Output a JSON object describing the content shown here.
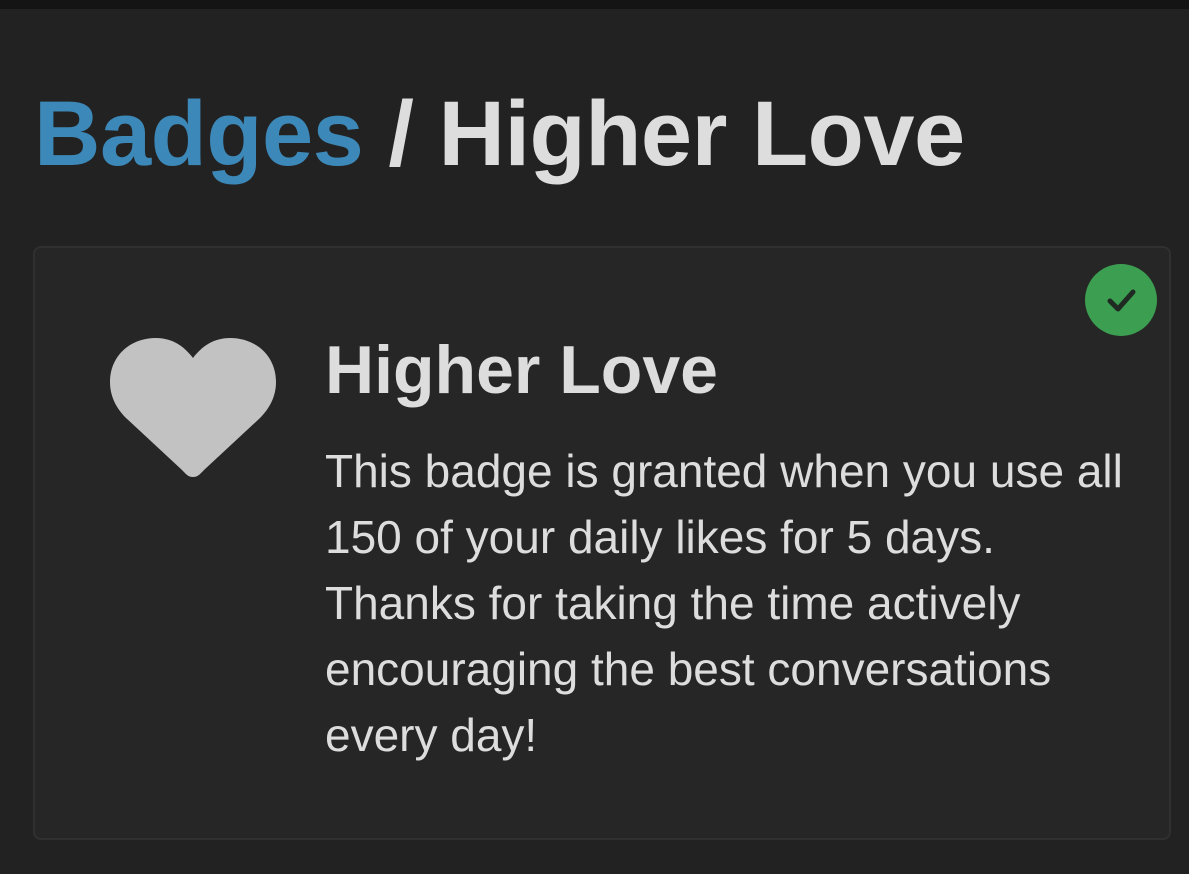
{
  "breadcrumb": {
    "parent_label": "Badges",
    "separator": "/",
    "current_label": "Higher Love"
  },
  "badge": {
    "name": "Higher Love",
    "description": "This badge is granted when you use all 150 of your daily likes for 5 days. Thanks for taking the time actively encouraging the best conversations every day!",
    "icon": "heart-icon",
    "granted": true,
    "status_icon": "check-icon"
  },
  "colors": {
    "background": "#222222",
    "card_background": "#262626",
    "link": "#3c88b8",
    "text": "#dddddd",
    "icon": "#c2c2c2",
    "granted_badge": "#3c9e50"
  }
}
